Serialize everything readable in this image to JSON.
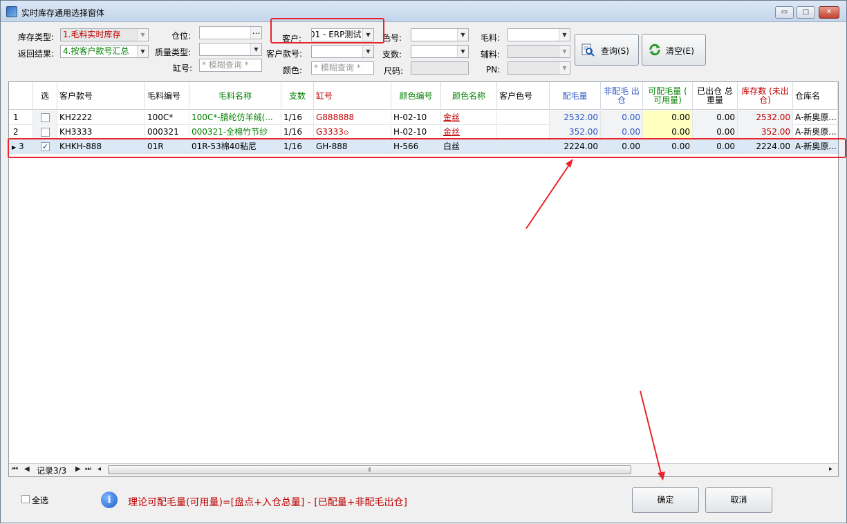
{
  "window": {
    "title": "实时库存通用选择窗体",
    "min_glyph": "▭",
    "max_glyph": "□",
    "close_glyph": "✕"
  },
  "filters": {
    "stock_type_label": "库存类型:",
    "stock_type_value": "1.毛料实时库存",
    "return_label": "返回结果:",
    "return_value": "4.按客户款号汇总",
    "location_label": "仓位:",
    "location_value": "",
    "quality_label": "质量类型:",
    "quality_value": "",
    "vat_label": "缸号:",
    "vat_placeholder": "* 模糊查询 *",
    "customer_label": "客户:",
    "customer_value": "01 - ERP测试",
    "style_label": "客户款号:",
    "style_value": "",
    "color_label": "颜色:",
    "color_placeholder": "* 模糊查询 *",
    "color_no_label": "色号:",
    "color_no_value": "",
    "count_label": "支数:",
    "count_value": "",
    "size_label": "尺码:",
    "size_value": "",
    "wool_label": "毛料:",
    "wool_value": "",
    "accessory_label": "辅料:",
    "accessory_value": "",
    "pn_label": "PN:",
    "pn_value": ""
  },
  "buttons": {
    "query": "查询(S)",
    "clear": "清空(E)",
    "ok": "确定",
    "cancel": "取消"
  },
  "grid": {
    "headers": {
      "select": "选",
      "style": "客户款号",
      "wool_code": "毛料编号",
      "wool_name": "毛料名称",
      "count": "支数",
      "vat": "缸号",
      "color_code": "颜色编号",
      "color_name": "颜色名称",
      "cust_color": "客户色号",
      "allocated": "配毛量",
      "non_alloc": "非配毛 出仓",
      "avail": "可配毛量 ( 可用量)",
      "shipped": "已出仓 总重量",
      "stock": "库存数 (未出仓)",
      "warehouse": "仓库名"
    },
    "rows": [
      {
        "idx": "1",
        "checked": false,
        "style": "KH2222",
        "wool_code": "100C*",
        "wool_name": "100C*-腈纶仿羊绒(...",
        "count": "1/16",
        "vat": "G888888",
        "color_code": "H-02-10",
        "color_name": "金丝",
        "cust_color": "",
        "allocated": "2532.00",
        "non_alloc": "0.00",
        "avail": "0.00",
        "shipped": "0.00",
        "stock": "2532.00",
        "warehouse": "A-新奥原..."
      },
      {
        "idx": "2",
        "checked": false,
        "style": "KH3333",
        "wool_code": "000321",
        "wool_name": "000321-全棉竹节纱",
        "count": "1/16",
        "vat": "G3333",
        "color_code": "H-02-10",
        "color_name": "金丝",
        "cust_color": "",
        "allocated": "352.00",
        "non_alloc": "0.00",
        "avail": "0.00",
        "shipped": "0.00",
        "stock": "352.00",
        "warehouse": "A-新奥原..."
      },
      {
        "idx": "3",
        "checked": true,
        "style": "KHKH-888",
        "wool_code": "01R",
        "wool_name": "01R-53棉40粘尼",
        "count": "1/16",
        "vat": "GH-888",
        "color_code": "H-566",
        "color_name": "白丝",
        "cust_color": "",
        "allocated": "2224.00",
        "non_alloc": "0.00",
        "avail": "0.00",
        "shipped": "0.00",
        "stock": "2224.00",
        "warehouse": "A-新奥原..."
      }
    ],
    "record_text": "记录3/3"
  },
  "footer": {
    "select_all": "全选",
    "formula": "理论可配毛量(可用量)=[盘点+入仓总量] - [已配量+非配毛出仓]"
  }
}
